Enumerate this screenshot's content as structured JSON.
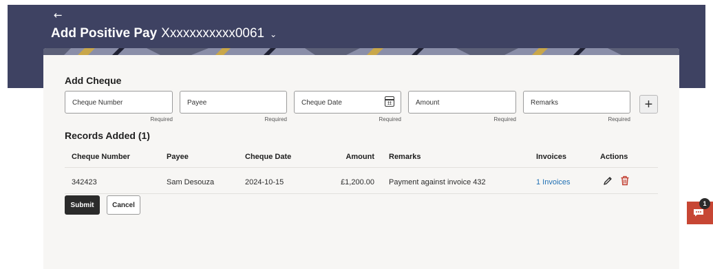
{
  "header": {
    "back_icon": "arrow-left-icon",
    "title": "Add Positive Pay",
    "account": "Xxxxxxxxxxx0061",
    "chevron_icon": "chevron-down-icon"
  },
  "add_cheque": {
    "title": "Add Cheque",
    "fields": [
      {
        "placeholder": "Cheque Number",
        "hint": "Required"
      },
      {
        "placeholder": "Payee",
        "hint": "Required"
      },
      {
        "placeholder": "Cheque Date",
        "hint": "Required",
        "icon": "calendar-icon"
      },
      {
        "placeholder": "Amount",
        "hint": "Required"
      },
      {
        "placeholder": "Remarks",
        "hint": "Required"
      }
    ],
    "add_button": "+"
  },
  "records": {
    "title": "Records Added (1)",
    "columns": [
      "Cheque Number",
      "Payee",
      "Cheque Date",
      "Amount",
      "Remarks",
      "Invoices",
      "Actions"
    ],
    "rows": [
      {
        "cheque_number": "342423",
        "payee": "Sam Desouza",
        "cheque_date": "2024-10-15",
        "amount": "£1,200.00",
        "remarks": "Payment against invoice 432",
        "invoices": "1 Invoices",
        "actions": [
          "edit-icon",
          "delete-icon"
        ]
      }
    ]
  },
  "buttons": {
    "submit": "Submit",
    "cancel": "Cancel"
  },
  "chat": {
    "icon": "chat-icon",
    "badge": "1"
  },
  "colors": {
    "header_bg": "#3e4262",
    "card_bg": "#f7f6f4",
    "primary_button": "#2b2b2b",
    "link": "#1e6fb3",
    "delete": "#c0392b",
    "chat_bg": "#c74634"
  }
}
